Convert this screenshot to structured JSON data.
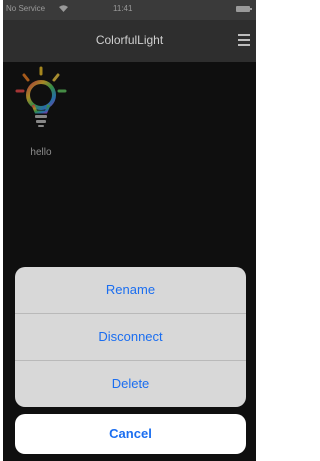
{
  "status_bar": {
    "carrier": "No Service",
    "time": "11:41"
  },
  "nav": {
    "title": "ColorfulLight"
  },
  "devices": [
    {
      "name": "hello"
    }
  ],
  "action_sheet": {
    "items": [
      {
        "label": "Rename"
      },
      {
        "label": "Disconnect"
      },
      {
        "label": "Delete"
      }
    ],
    "cancel_label": "Cancel"
  },
  "colors": {
    "accent": "#1b6ef0",
    "nav_bg": "#2e2e2e",
    "screen_bg": "#171717"
  },
  "icons": [
    "wifi-icon",
    "battery-icon",
    "menu-icon",
    "light-bulb-icon"
  ]
}
